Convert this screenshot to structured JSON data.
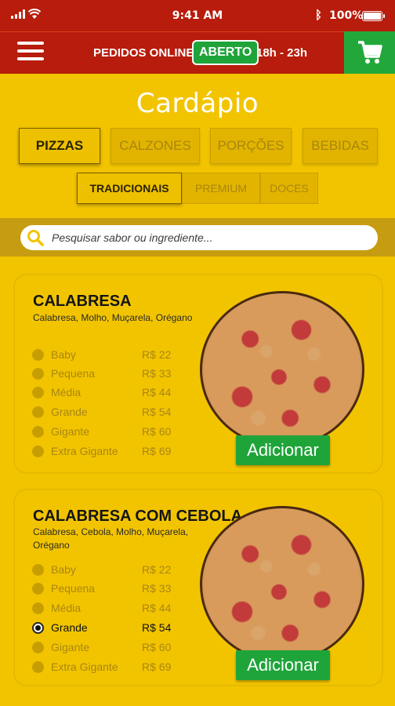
{
  "status": {
    "time": "9:41 AM",
    "battery": "100%"
  },
  "header": {
    "pedidos_label": "PEDIDOS ONLINE",
    "status_badge": "ABERTO",
    "hours": "18h - 23h"
  },
  "page_title": "Cardápio",
  "categories": [
    "PIZZAS",
    "CALZONES",
    "PORÇÕES",
    "BEBIDAS"
  ],
  "subcategories": [
    "TRADICIONAIS",
    "PREMIUM",
    "DOCES"
  ],
  "search": {
    "placeholder": "Pesquisar sabor ou ingrediente..."
  },
  "products": [
    {
      "name": "CALABRESA",
      "description": "Calabresa, Molho, Muçarela, Orégano",
      "sizes": [
        {
          "label": "Baby",
          "price": "R$ 22"
        },
        {
          "label": "Pequena",
          "price": "R$ 33"
        },
        {
          "label": "Média",
          "price": "R$ 44"
        },
        {
          "label": "Grande",
          "price": "R$ 54"
        },
        {
          "label": "Gigante",
          "price": "R$ 60"
        },
        {
          "label": "Extra Gigante",
          "price": "R$ 69"
        }
      ],
      "selected_size": null,
      "add_label": "Adicionar"
    },
    {
      "name": "CALABRESA COM CEBOLA",
      "description": "Calabresa, Cebola, Molho, Muçarela, Orégano",
      "sizes": [
        {
          "label": "Baby",
          "price": "R$ 22"
        },
        {
          "label": "Pequena",
          "price": "R$ 33"
        },
        {
          "label": "Média",
          "price": "R$ 44"
        },
        {
          "label": "Grande",
          "price": "R$ 54"
        },
        {
          "label": "Gigante",
          "price": "R$ 60"
        },
        {
          "label": "Extra Gigante",
          "price": "R$ 69"
        }
      ],
      "selected_size": "Grande",
      "add_label": "Adicionar"
    }
  ],
  "colors": {
    "header_red": "#b71c0c",
    "background_yellow": "#f2c400",
    "accent_green": "#1fa43a",
    "search_band": "#c69c10"
  },
  "icons": {
    "menu": "hamburger-icon",
    "cart": "cart-icon",
    "search": "magnifier-icon",
    "signal": "signal-icon",
    "wifi": "wifi-icon",
    "bluetooth": "bluetooth-icon",
    "battery": "battery-icon"
  }
}
